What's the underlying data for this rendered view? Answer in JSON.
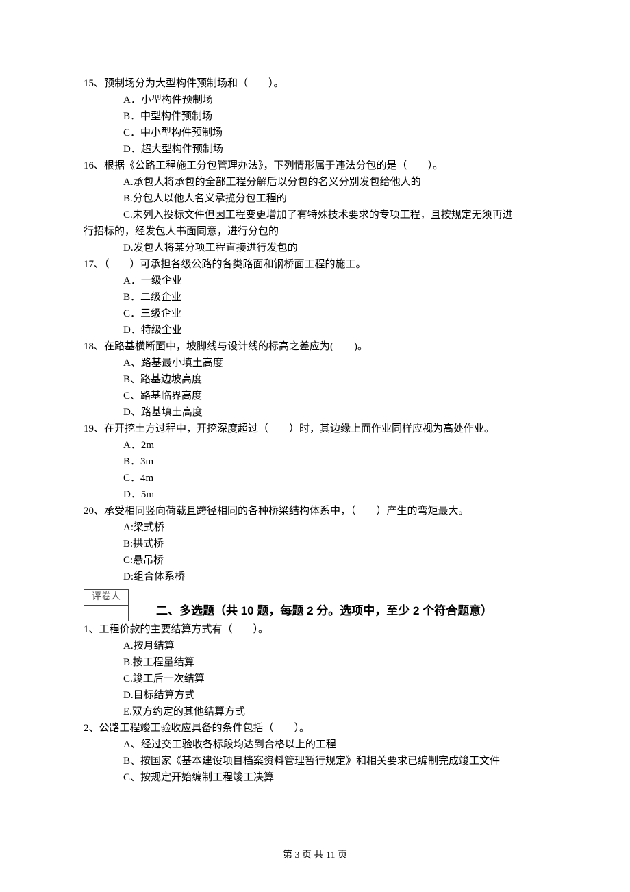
{
  "questions": [
    {
      "num": "15",
      "stem": "15、预制场分为大型构件预制场和（　　）。",
      "opts": [
        "A．小型构件预制场",
        "B．中型构件预制场",
        "C．中小型构件预制场",
        "D．超大型构件预制场"
      ]
    },
    {
      "num": "16",
      "stem": "16、根据《公路工程施工分包管理办法》，下列情形属于违法分包的是（　　）。",
      "opts": [
        "A.承包人将承包的全部工程分解后以分包的名义分别发包给他人的",
        "B.分包人以他人名义承揽分包工程的",
        "C.未列入投标文件但因工程变更增加了有特殊技术要求的专项工程，且按规定无须再进",
        "D.发包人将某分项工程直接进行发包的"
      ],
      "cont": "行招标的，经发包人书面同意，进行分包的"
    },
    {
      "num": "17",
      "stem": "17、（　　）可承担各级公路的各类路面和钢桥面工程的施工。",
      "opts": [
        "A．一级企业",
        "B．二级企业",
        "C．三级企业",
        "D．特级企业"
      ]
    },
    {
      "num": "18",
      "stem": "18、在路基横断面中，坡脚线与设计线的标高之差应为(　　)。",
      "opts": [
        "A、路基最小填土高度",
        "B、路基边坡高度",
        "C、路基临界高度",
        "D、路基填土高度"
      ]
    },
    {
      "num": "19",
      "stem": "19、在开挖土方过程中，开挖深度超过（　　）时，其边缘上面作业同样应视为高处作业。",
      "opts": [
        "A．2m",
        "B．3m",
        "C．4m",
        "D．5m"
      ]
    },
    {
      "num": "20",
      "stem": "20、承受相同竖向荷载且跨径相同的各种桥梁结构体系中，（　　）产生的弯矩最大。",
      "opts": [
        "A:梁式桥",
        "B:拱式桥",
        "C:悬吊桥",
        "D:组合体系桥"
      ]
    }
  ],
  "marker_label": "评卷人",
  "section_title": "二、多选题（共 10 题，每题 2 分。选项中，至少 2 个符合题意）",
  "questions2": [
    {
      "num": "1",
      "stem": "1、工程价款的主要结算方式有（　　）。",
      "opts": [
        "A.按月结算",
        "B.按工程量结算",
        "C.竣工后一次结算",
        "D.目标结算方式",
        "E.双方约定的其他结算方式"
      ]
    },
    {
      "num": "2",
      "stem": "2、公路工程竣工验收应具备的条件包括（　　）。",
      "opts": [
        "A、经过交工验收各标段均达到合格以上的工程",
        "B、按国家《基本建设项目档案资料管理暂行规定》和相关要求已编制完成竣工文件",
        "C、按规定开始编制工程竣工决算"
      ]
    }
  ],
  "footer": "第 3 页 共 11 页"
}
